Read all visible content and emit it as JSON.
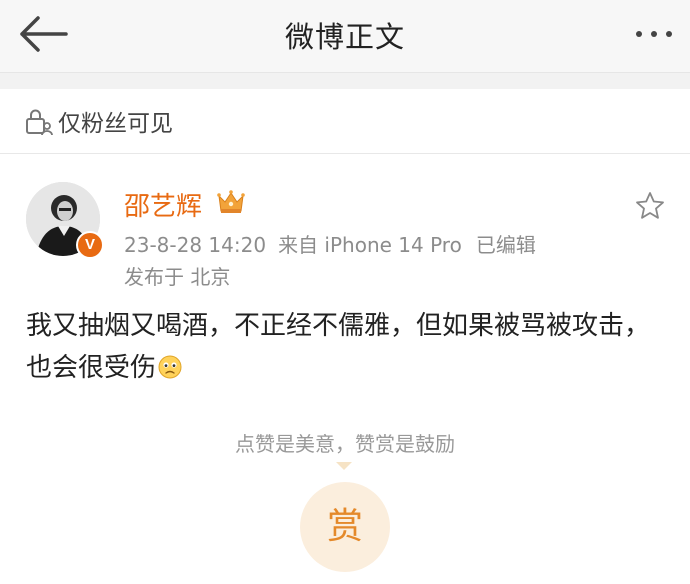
{
  "header": {
    "title": "微博正文"
  },
  "visibility": {
    "label": "仅粉丝可见"
  },
  "post": {
    "author": "邵艺辉",
    "verified_badge": "V",
    "time": "23-8-28 14:20",
    "source": "来自 iPhone 14 Pro",
    "edited": "已编辑",
    "location": "发布于 北京",
    "text": "我又抽烟又喝酒，不正经不儒雅，但如果被骂被攻击，也会很受伤"
  },
  "reward": {
    "tip": "点赞是美意，赞赏是鼓励",
    "button_label": "赏"
  },
  "colors": {
    "accent": "#e86a12",
    "meta": "#8c8c8c",
    "header_bg": "#f7f7f7"
  }
}
